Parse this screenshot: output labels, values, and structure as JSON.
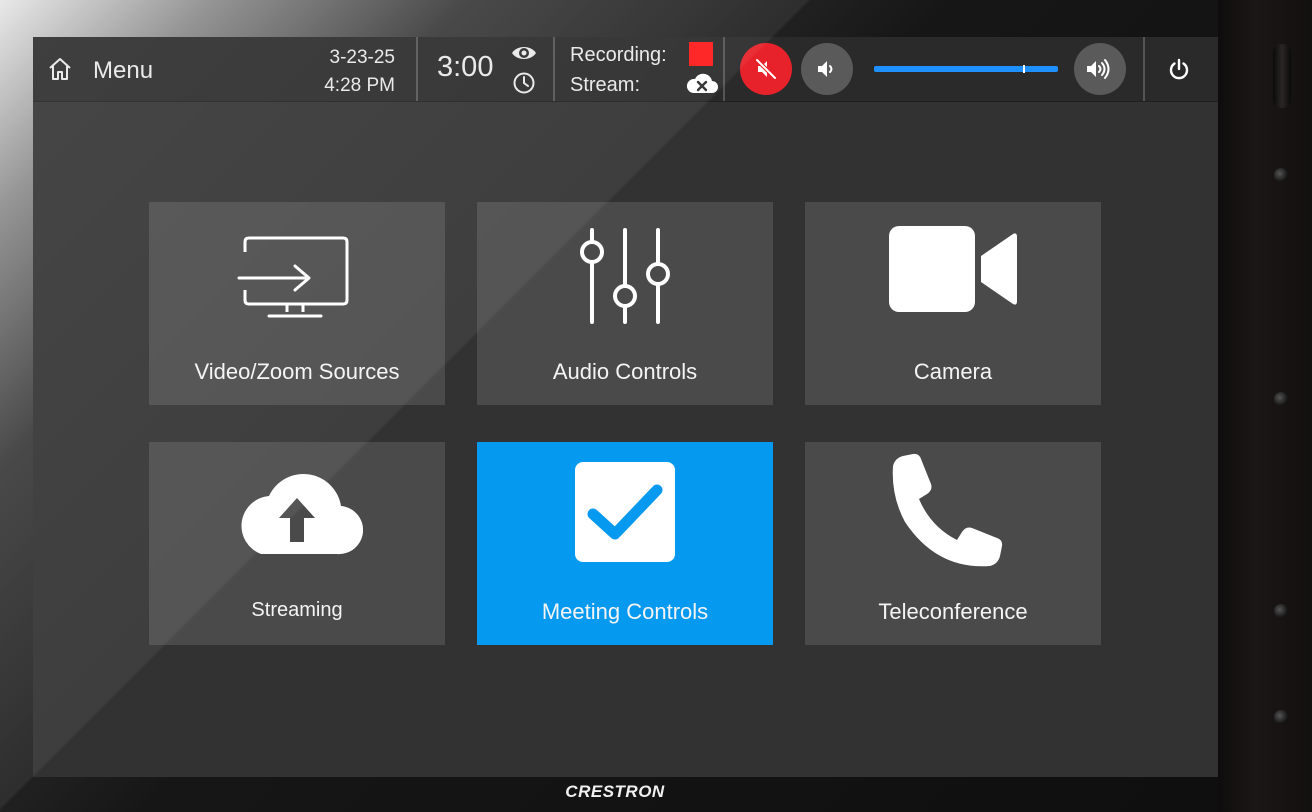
{
  "header": {
    "menu_label": "Menu",
    "date": "3-23-25",
    "time": "4:28 PM",
    "timer": "3:00",
    "recording_label": "Recording:",
    "stream_label": "Stream:",
    "recording_color": "#ff1a1a"
  },
  "volume": {
    "level": 0.81,
    "muted": true,
    "track_color": "#1e90ff"
  },
  "tiles": [
    {
      "label": "Video/Zoom Sources",
      "icon": "display-input-icon",
      "active": false
    },
    {
      "label": "Audio Controls",
      "icon": "mixer-sliders-icon",
      "active": false
    },
    {
      "label": "Camera",
      "icon": "video-camera-icon",
      "active": false
    },
    {
      "label": "Streaming",
      "icon": "cloud-upload-icon",
      "active": false
    },
    {
      "label": "Meeting Controls",
      "icon": "checkbox-icon",
      "active": true
    },
    {
      "label": "Teleconference",
      "icon": "phone-icon",
      "active": false
    }
  ],
  "brand": {
    "name": "CRESTRON"
  },
  "colors": {
    "accent": "#0599ef",
    "tile": "#4a4a4a",
    "screen": "#323232",
    "mute_active": "#e8222a"
  }
}
